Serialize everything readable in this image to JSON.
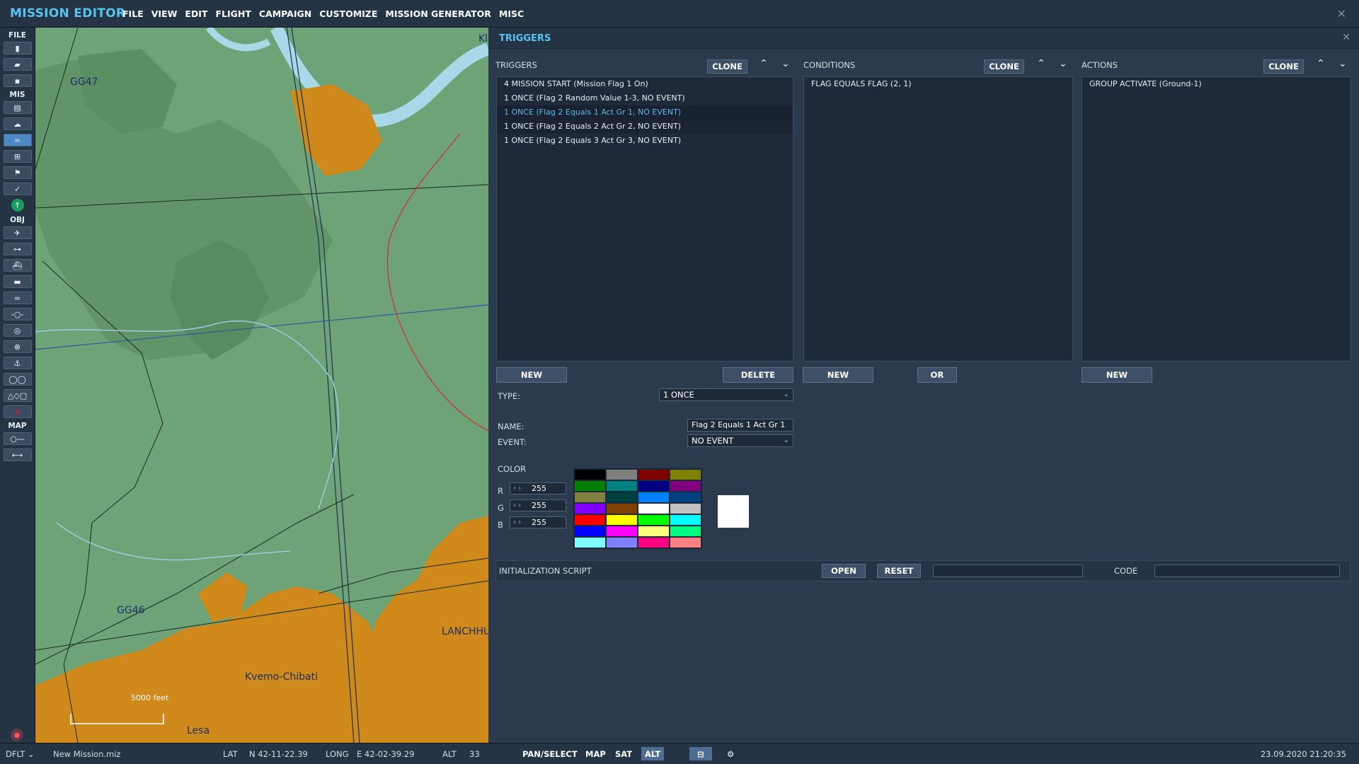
{
  "app": {
    "title": "MISSION EDITOR"
  },
  "menu": [
    "FILE",
    "VIEW",
    "EDIT",
    "FLIGHT",
    "CAMPAIGN",
    "CUSTOMIZE",
    "MISSION GENERATOR",
    "MISC"
  ],
  "toolbar": {
    "sections": {
      "file": "FILE",
      "mis": "MIS",
      "obj": "OBJ",
      "map": "MAP"
    }
  },
  "map": {
    "grid_labels": [
      "GG47",
      "GG46"
    ],
    "place_labels": [
      "Kvemo-Chibati",
      "LANCHHU",
      "Lesa",
      "Kl"
    ],
    "scale_text": "5000 feet"
  },
  "panel": {
    "title": "TRIGGERS",
    "triggers": {
      "header": "TRIGGERS",
      "clone_label": "CLONE",
      "items": [
        "4 MISSION START (Mission Flag 1 On)",
        "1 ONCE (Flag 2 Random Value 1-3, NO EVENT)",
        "1 ONCE (Flag 2 Equals 1 Act Gr 1, NO EVENT)",
        "1 ONCE (Flag 2 Equals 2 Act Gr 2, NO EVENT)",
        "1 ONCE (Flag 2 Equals 3 Act Gr 3, NO EVENT)"
      ],
      "selected_index": 2,
      "new_label": "NEW",
      "delete_label": "DELETE"
    },
    "conditions": {
      "header": "CONDITIONS",
      "clone_label": "CLONE",
      "items": [
        "FLAG EQUALS FLAG (2, 1)"
      ],
      "new_label": "NEW",
      "or_label": "OR"
    },
    "actions": {
      "header": "ACTIONS",
      "clone_label": "CLONE",
      "items": [
        "GROUP ACTIVATE (Ground-1)"
      ],
      "new_label": "NEW"
    },
    "type": {
      "label": "TYPE:",
      "value": "1 ONCE"
    },
    "name": {
      "label": "NAME:",
      "value": "Flag 2 Equals 1 Act Gr 1"
    },
    "event": {
      "label": "EVENT:",
      "value": "NO EVENT"
    },
    "color": {
      "label": "COLOR",
      "r_label": "R",
      "r": "255",
      "g_label": "G",
      "g": "255",
      "b_label": "B",
      "b": "255",
      "palette": [
        "#000000",
        "#808080",
        "#800000",
        "#808000",
        "#008000",
        "#008080",
        "#000080",
        "#800080",
        "#808040",
        "#004040",
        "#0080ff",
        "#004080",
        "#8000ff",
        "#804000",
        "#ffffff",
        "#c0c0c0",
        "#ff0000",
        "#ffff00",
        "#00ff00",
        "#00ffff",
        "#0000ff",
        "#ff00ff",
        "#ffff80",
        "#00ff80",
        "#80ffff",
        "#8080ff",
        "#ff0080",
        "#ff8080"
      ],
      "preview": "#ffffff"
    },
    "init_script": {
      "label": "INITIALIZATION SCRIPT",
      "open_label": "OPEN",
      "reset_label": "RESET",
      "code_label": "CODE"
    }
  },
  "status": {
    "mode": "DFLT",
    "file": "New Mission.miz",
    "lat_label": "LAT",
    "lat": "N 42-11-22.39",
    "long_label": "LONG",
    "long": "E 42-02-39.29",
    "alt_label": "ALT",
    "alt": "33",
    "buttons": [
      "PAN/SELECT",
      "MAP",
      "SAT",
      "ALT"
    ],
    "active_button": "ALT",
    "datetime": "23.09.2020 21:20:35"
  },
  "colors": {
    "accent": "#59c3ef",
    "panel": "#2c3a4d",
    "map_green": "#6ea277",
    "urban": "#d08a1c",
    "water": "#a9d8e8"
  }
}
